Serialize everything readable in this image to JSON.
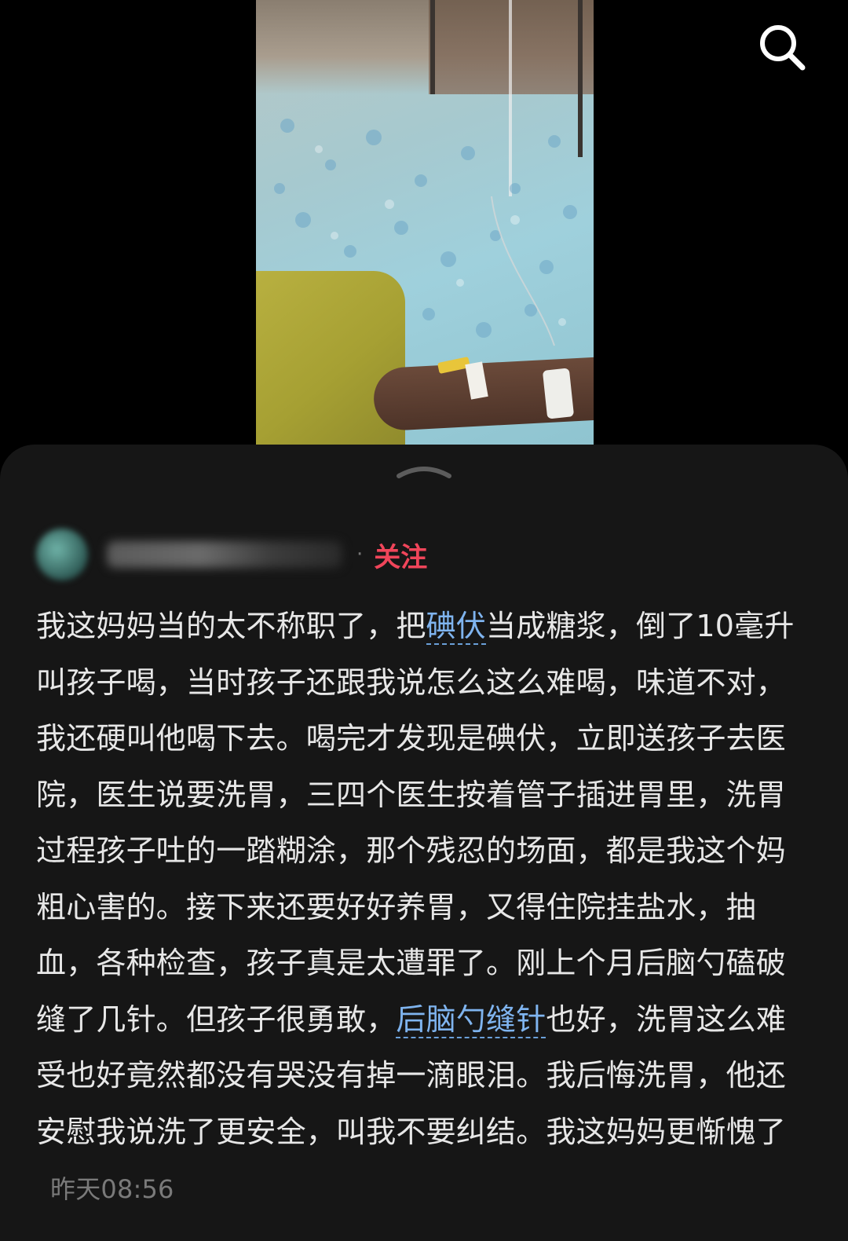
{
  "header": {
    "search_icon": "search-icon"
  },
  "comment": {
    "author_name": "",
    "separator": "·",
    "follow_label": "关注",
    "text_part1": "我这妈妈当的太不称职了，把",
    "link1": "碘伏",
    "text_part2": "当成糖浆，倒了10毫升叫孩子喝，当时孩子还跟我说怎么这么难喝，味道不对，我还硬叫他喝下去。喝完才发现是碘伏，立即送孩子去医院，医生说要洗胃，三四个医生按着管子插进胃里，洗胃过程孩子吐的一踏糊涂，那个残忍的场面，都是我这个妈粗心害的。接下来还要好好养胃，又得住院挂盐水，抽血，各种检查，孩子真是太遭罪了。刚上个月后脑勺磕破缝了几针。但孩子很勇敢，",
    "link2": "后脑勺缝针",
    "text_part3": "也好，洗胃这么难受也好竟然都没有哭没有掉一滴眼泪。我后悔洗胃，他还安慰我说洗了更安全，叫我不要纠结。我这妈妈更惭愧了",
    "timestamp": "昨天08:56"
  },
  "colors": {
    "background": "#000000",
    "sheet": "#161616",
    "text": "#e7e7e7",
    "link": "#7fb4ef",
    "follow": "#f0455a",
    "timestamp": "#7a7a7a"
  }
}
